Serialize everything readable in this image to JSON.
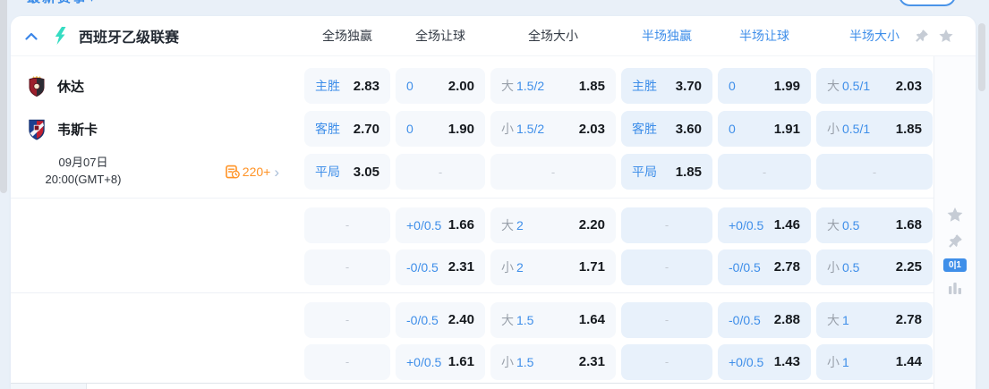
{
  "topbar": {
    "filter_label": "最新赛事",
    "caret": "▾"
  },
  "header": {
    "title": "西班牙乙级联赛",
    "columns": [
      {
        "label": "全场独赢",
        "tone": "dark"
      },
      {
        "label": "全场让球",
        "tone": "dark"
      },
      {
        "label": "全场大小",
        "tone": "dark"
      },
      {
        "label": "半场独赢",
        "tone": "blue"
      },
      {
        "label": "半场让球",
        "tone": "blue"
      },
      {
        "label": "半场大小",
        "tone": "blue"
      }
    ]
  },
  "match": {
    "home": "休达",
    "away": "韦斯卡",
    "date_line1": "09月07日",
    "date_line2": "20:00(GMT+8)",
    "markets_count": "220+",
    "markets_arrow": "›"
  },
  "sections": [
    {
      "rows": [
        {
          "cells": [
            {
              "b": "主胜",
              "v": "2.83"
            },
            {
              "b": "0",
              "v": "2.00"
            },
            {
              "g": "大",
              "b": "1.5/2",
              "v": "1.85"
            },
            {
              "b": "主胜",
              "v": "3.70"
            },
            {
              "b": "0",
              "v": "1.99"
            },
            {
              "g": "大",
              "b": "0.5/1",
              "v": "2.03"
            }
          ]
        },
        {
          "cells": [
            {
              "b": "客胜",
              "v": "2.70"
            },
            {
              "b": "0",
              "v": "1.90"
            },
            {
              "g": "小",
              "b": "1.5/2",
              "v": "2.03"
            },
            {
              "b": "客胜",
              "v": "3.60"
            },
            {
              "b": "0",
              "v": "1.91"
            },
            {
              "g": "小",
              "b": "0.5/1",
              "v": "1.85"
            }
          ]
        },
        {
          "cells": [
            {
              "b": "平局",
              "v": "3.05"
            },
            {
              "d": "-"
            },
            {
              "d": "-"
            },
            {
              "b": "平局",
              "v": "1.85"
            },
            {
              "d": "-"
            },
            {
              "d": "-"
            }
          ]
        }
      ]
    },
    {
      "rows": [
        {
          "cells": [
            {
              "d": "-"
            },
            {
              "b": "+0/0.5",
              "v": "1.66"
            },
            {
              "g": "大",
              "b": "2",
              "v": "2.20"
            },
            {
              "d": "-"
            },
            {
              "b": "+0/0.5",
              "v": "1.46"
            },
            {
              "g": "大",
              "b": "0.5",
              "v": "1.68"
            }
          ]
        },
        {
          "cells": [
            {
              "d": "-"
            },
            {
              "b": "-0/0.5",
              "v": "2.31"
            },
            {
              "g": "小",
              "b": "2",
              "v": "1.71"
            },
            {
              "d": "-"
            },
            {
              "b": "-0/0.5",
              "v": "2.78"
            },
            {
              "g": "小",
              "b": "0.5",
              "v": "2.25"
            }
          ]
        }
      ]
    },
    {
      "rows": [
        {
          "cells": [
            {
              "d": "-"
            },
            {
              "b": "-0/0.5",
              "v": "2.40"
            },
            {
              "g": "大",
              "b": "1.5",
              "v": "1.64"
            },
            {
              "d": "-"
            },
            {
              "b": "-0/0.5",
              "v": "2.88"
            },
            {
              "g": "大",
              "b": "1",
              "v": "2.78"
            }
          ]
        },
        {
          "cells": [
            {
              "d": "-"
            },
            {
              "b": "+0/0.5",
              "v": "1.61"
            },
            {
              "g": "小",
              "b": "1.5",
              "v": "2.31"
            },
            {
              "d": "-"
            },
            {
              "b": "+0/0.5",
              "v": "1.43"
            },
            {
              "g": "小",
              "b": "1",
              "v": "1.44"
            }
          ]
        }
      ]
    }
  ],
  "right_rail": {
    "score_toggle": "0|1"
  },
  "colors": {
    "accent_blue": "#3e8ee9",
    "odds_dark": "#15191e",
    "gray_label": "#9aa1ab",
    "orange": "#ff9326",
    "ft_cell_bg": "#f5f8fc",
    "ht_cell_bg": "#e8f1fb",
    "icon_gray": "#c6ccd5"
  }
}
